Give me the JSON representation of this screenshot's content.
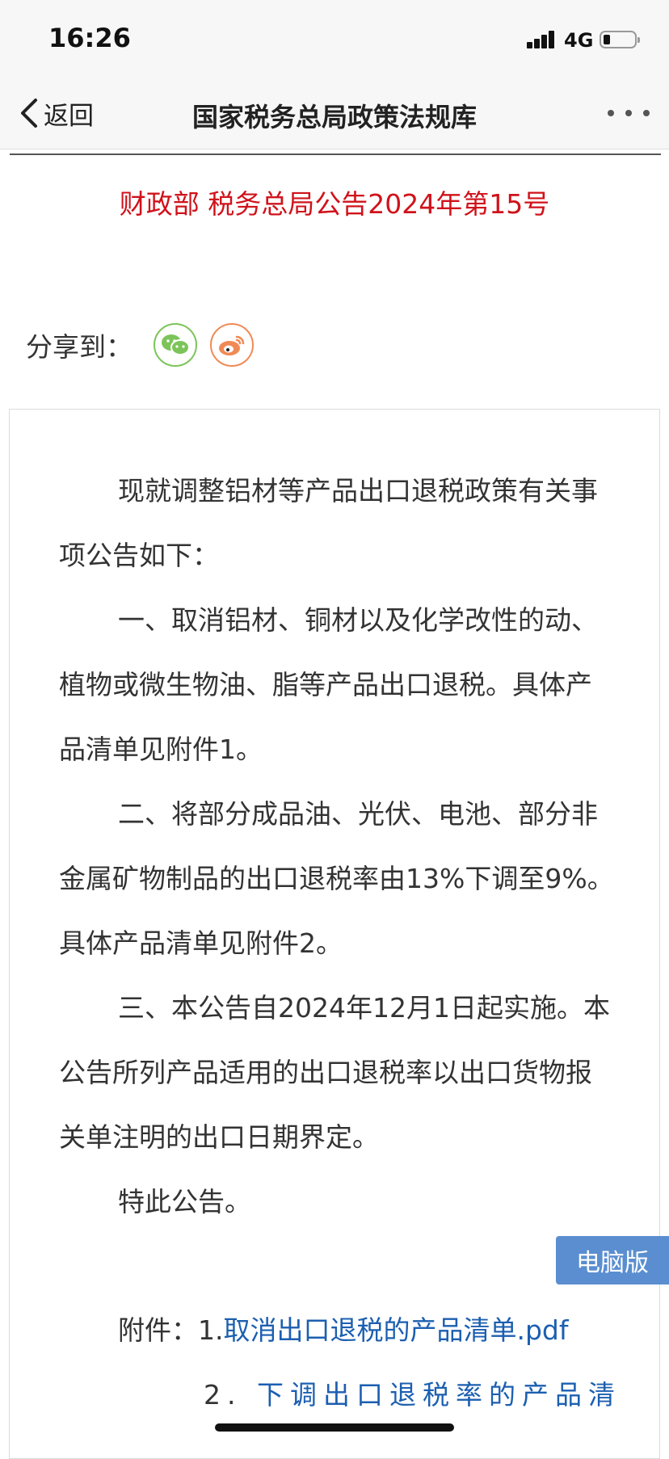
{
  "status_bar": {
    "time": "16:26",
    "network": "4G"
  },
  "nav": {
    "back_label": "返回",
    "title": "国家税务总局政策法规库"
  },
  "document": {
    "title": "财政部 税务总局公告2024年第15号",
    "share_label": "分享到：",
    "paragraphs": [
      "现就调整铝材等产品出口退税政策有关事项公告如下：",
      "一、取消铝材、铜材以及化学改性的动、植物或微生物油、脂等产品出口退税。具体产品清单见附件1。",
      "二、将部分成品油、光伏、电池、部分非金属矿物制品的出口退税率由13%下调至9%。具体产品清单见附件2。",
      "三、本公告自2024年12月1日起实施。本公告所列产品适用的出口退税率以出口货物报关单注明的出口日期界定。",
      "特此公告。"
    ],
    "attachments_label": "附件：",
    "attachment1_prefix": "1.",
    "attachment1_link": "取消出口退税的产品清单.pdf",
    "attachment2_prefix": "2.",
    "attachment2_link": "下调出口退税率的产品清"
  },
  "pc_version_label": "电脑版",
  "icons": [
    "back-chevron-icon",
    "more-icon",
    "wechat-icon",
    "weibo-icon",
    "signal-icon",
    "battery-icon"
  ],
  "colors": {
    "title_red": "#d0121b",
    "link_blue": "#1c5fb0",
    "pc_button": "#5a8ed0",
    "wechat_green": "#7cc45a",
    "weibo_orange": "#f08a55"
  }
}
